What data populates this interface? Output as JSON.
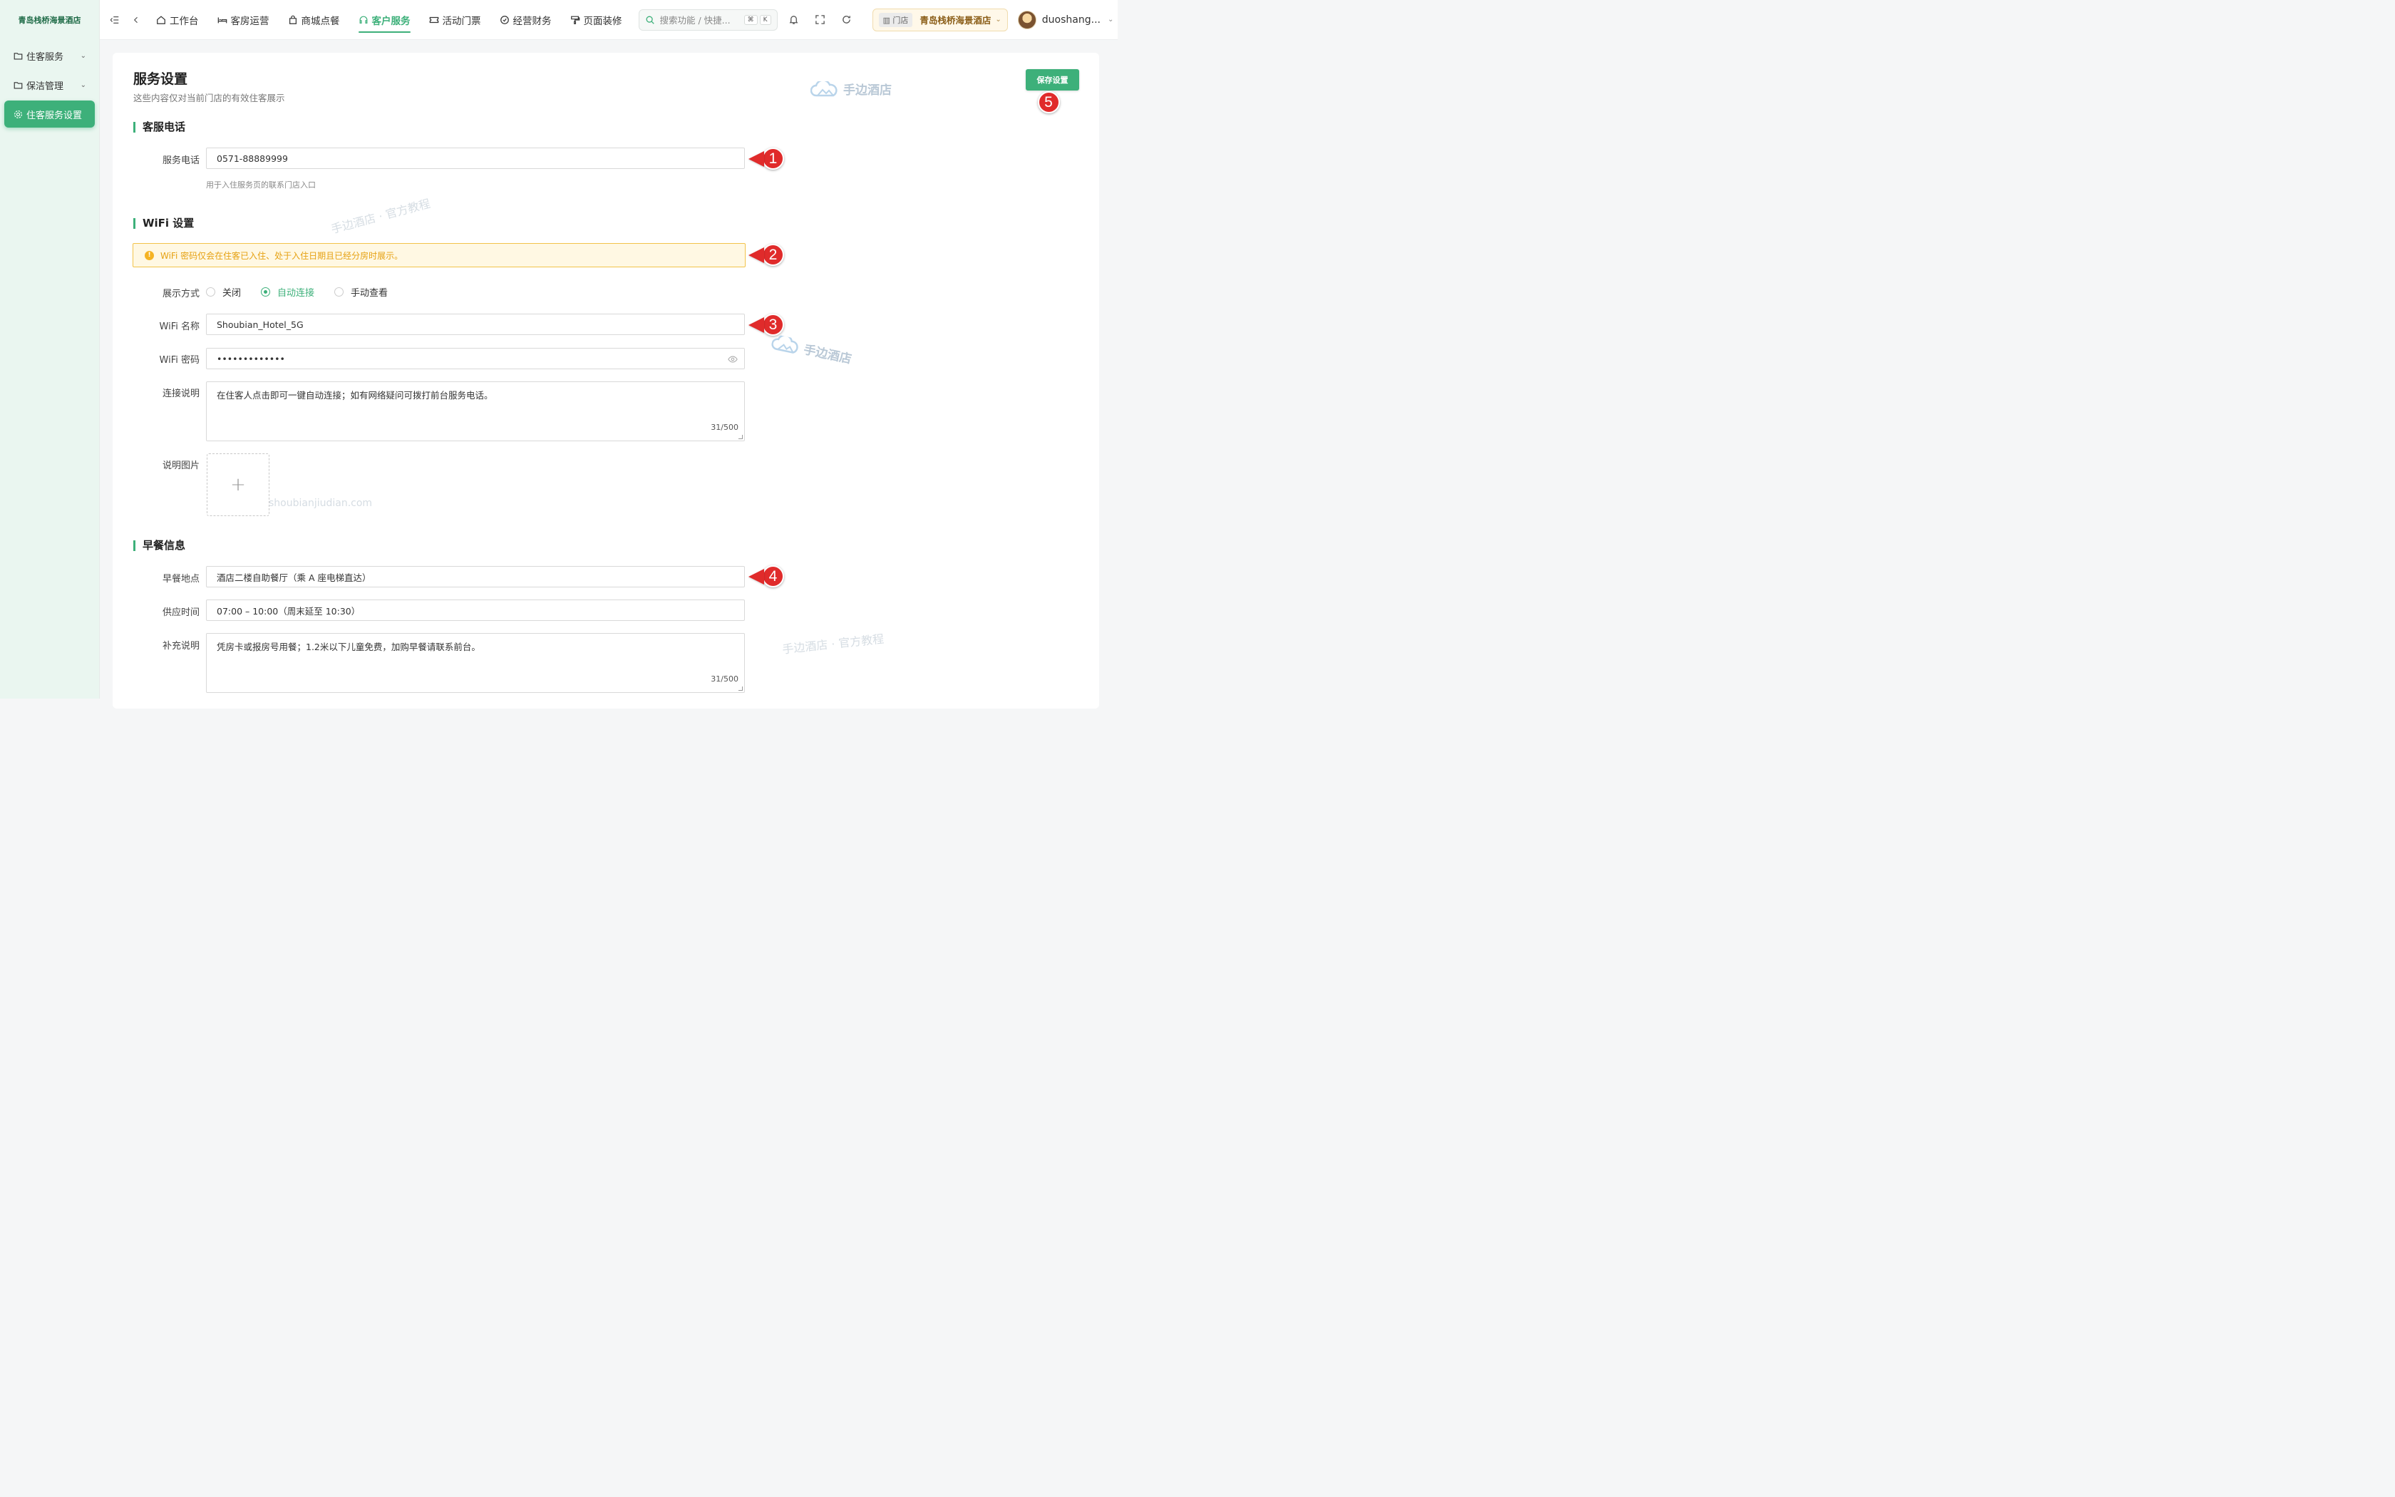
{
  "brand": "青岛栈桥海景酒店",
  "sidebar": {
    "items": [
      {
        "label": "住客服务",
        "has_chevron": true,
        "active": false
      },
      {
        "label": "保洁管理",
        "has_chevron": true,
        "active": false
      },
      {
        "label": "住客服务设置",
        "has_chevron": false,
        "active": true
      }
    ]
  },
  "topnav": {
    "items": [
      {
        "label": "工作台",
        "icon": "home-icon"
      },
      {
        "label": "客房运营",
        "icon": "bed-icon"
      },
      {
        "label": "商城点餐",
        "icon": "bag-icon"
      },
      {
        "label": "客户服务",
        "icon": "headset-icon",
        "active": true
      },
      {
        "label": "活动门票",
        "icon": "ticket-icon"
      },
      {
        "label": "经营财务",
        "icon": "finance-icon"
      },
      {
        "label": "页面装修",
        "icon": "paint-icon"
      }
    ],
    "search_placeholder": "搜索功能 / 快捷...",
    "shortcut": [
      "⌘",
      "K"
    ],
    "store_tag": "门店",
    "store_name": "青岛栈桥海景酒店",
    "username": "duoshang..."
  },
  "page": {
    "title": "服务设置",
    "subtitle": "这些内容仅对当前门店的有效住客展示",
    "save_label": "保存设置"
  },
  "sections": {
    "phone": {
      "title": "客服电话",
      "label": "服务电话",
      "value": "0571-88889999",
      "hint": "用于入住服务页的联系门店入口"
    },
    "wifi": {
      "title": "WiFi 设置",
      "alert": "WiFi 密码仅会在住客已入住、处于入住日期且已经分房时展示。",
      "display_label": "展示方式",
      "options": [
        "关闭",
        "自动连接",
        "手动查看"
      ],
      "selected": "自动连接",
      "name_label": "WiFi 名称",
      "name_value": "Shoubian_Hotel_5G",
      "password_label": "WiFi 密码",
      "password_value": "•••••••••••••",
      "desc_label": "连接说明",
      "desc_value": "在住客人点击即可一键自动连接；如有网络疑问可拨打前台服务电话。",
      "desc_count": "31/500",
      "image_label": "说明图片"
    },
    "breakfast": {
      "title": "早餐信息",
      "location_label": "早餐地点",
      "location_value": "酒店二楼自助餐厅（乘 A 座电梯直达）",
      "time_label": "供应时间",
      "time_value": "07:00 – 10:00（周末延至 10:30）",
      "note_label": "补充说明",
      "note_value": "凭房卡或报房号用餐；1.2米以下儿童免费，加购早餐请联系前台。",
      "note_count": "31/500"
    }
  },
  "callouts": [
    "1",
    "2",
    "3",
    "4",
    "5"
  ],
  "watermarks": {
    "logo_text": "手边酒店",
    "tutorial": "手边酒店 · 官方教程",
    "domain": "shoubianjiudian.com"
  },
  "colors": {
    "accent": "#3db07a",
    "callout": "#e02b2b",
    "warning": "#f5b323"
  }
}
